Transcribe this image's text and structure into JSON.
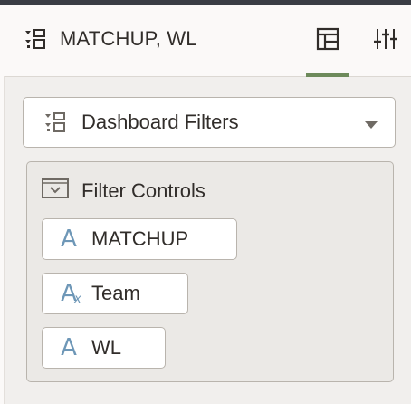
{
  "header": {
    "title": "MATCHUP, WL",
    "title_icon": "filter-layout-icon",
    "tabs": [
      {
        "name": "dashboard-tab",
        "icon": "dashboard-layout-icon",
        "active": true
      },
      {
        "name": "settings-tab",
        "icon": "sliders-icon",
        "active": false
      }
    ],
    "accent_color": "#6d8a5b"
  },
  "dropdown": {
    "label": "Dashboard Filters",
    "icon": "filter-layout-icon",
    "caret": "caret-down-icon"
  },
  "filter_controls": {
    "title": "Filter Controls",
    "icon": "collapse-box-icon",
    "items": [
      {
        "label": "MATCHUP",
        "glyph": "A",
        "type": "attribute"
      },
      {
        "label": "Team",
        "glyph": "A",
        "sub": "x",
        "type": "calculated-attribute"
      },
      {
        "label": "WL",
        "glyph": "A",
        "type": "attribute"
      }
    ],
    "glyph_color": "#6e97b7"
  }
}
